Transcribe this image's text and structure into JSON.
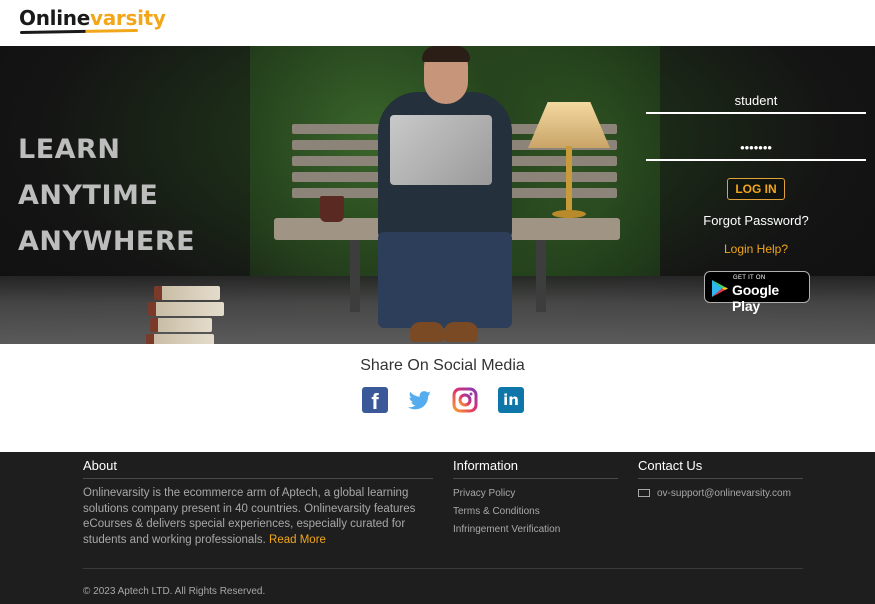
{
  "header": {
    "logo_part1": "Online",
    "logo_part2": "varsity"
  },
  "hero": {
    "tagline": [
      "LEARN",
      "ANYTIME",
      "ANYWHERE"
    ],
    "login": {
      "username": "student",
      "password": "•••••••",
      "login_button": "LOG IN",
      "forgot_password": "Forgot Password?",
      "login_help": "Login Help?"
    },
    "google_play": {
      "small_text": "GET IT ON",
      "big_text": "Google Play"
    }
  },
  "social": {
    "title": "Share On Social Media",
    "icons": [
      "facebook-icon",
      "twitter-icon",
      "instagram-icon",
      "linkedin-icon"
    ]
  },
  "footer": {
    "about": {
      "heading": "About",
      "text": "Onlinevarsity is the ecommerce arm of Aptech, a global learning solutions company present in 40 countries. Onlinevarsity features eCourses & delivers special experiences, especially curated for students and working professionals.",
      "read_more": "Read More"
    },
    "information": {
      "heading": "Information",
      "links": [
        "Privacy Policy",
        "Terms & Conditions",
        "Infringement Verification"
      ]
    },
    "contact": {
      "heading": "Contact Us",
      "email": "ov-support@onlinevarsity.com"
    },
    "copyright": "© 2023 Aptech LTD. All Rights Reserved."
  },
  "colors": {
    "accent": "#f2a61a",
    "footer_bg": "#1e1e1e",
    "facebook": "#3b5998",
    "twitter": "#55acee",
    "linkedin": "#0e76a8"
  }
}
